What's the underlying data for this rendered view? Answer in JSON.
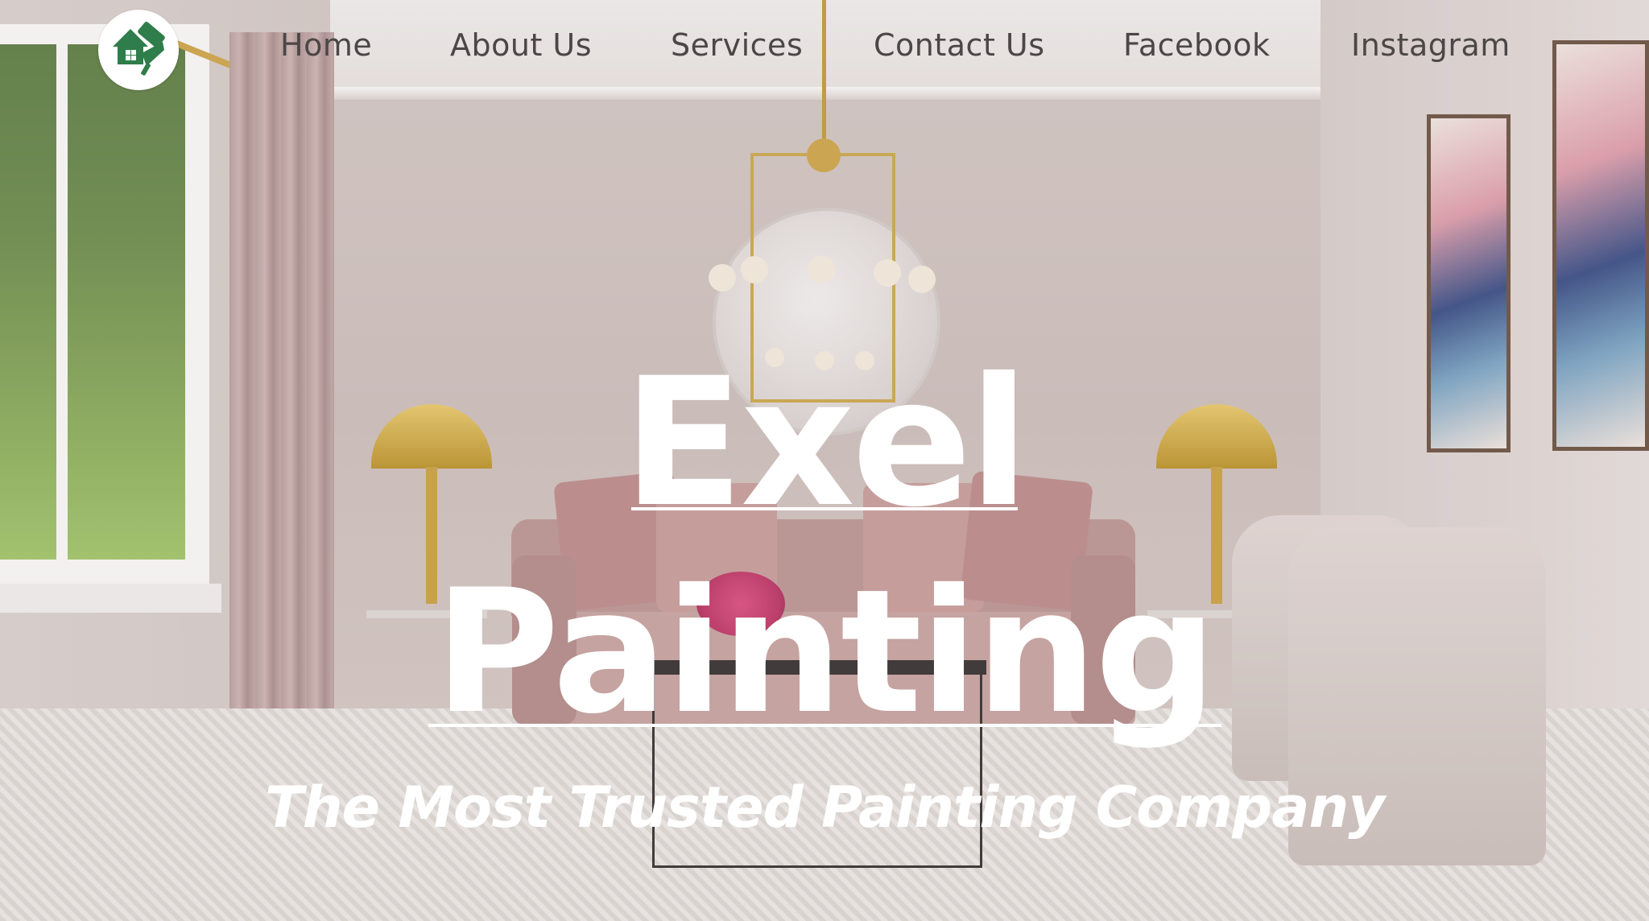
{
  "brand": {
    "logo_icon": "house-paint-roller-logo",
    "logo_color": "#2f7d4a"
  },
  "nav": {
    "items": [
      {
        "label": "Home"
      },
      {
        "label": "About Us"
      },
      {
        "label": "Services"
      },
      {
        "label": "Contact Us"
      },
      {
        "label": "Facebook"
      },
      {
        "label": "Instagram"
      }
    ],
    "text_color": "#4b4746"
  },
  "hero": {
    "title_line1": "Exel",
    "title_line2": "Painting",
    "tagline": "The Most Trusted Painting Company",
    "text_color": "#ffffff"
  }
}
